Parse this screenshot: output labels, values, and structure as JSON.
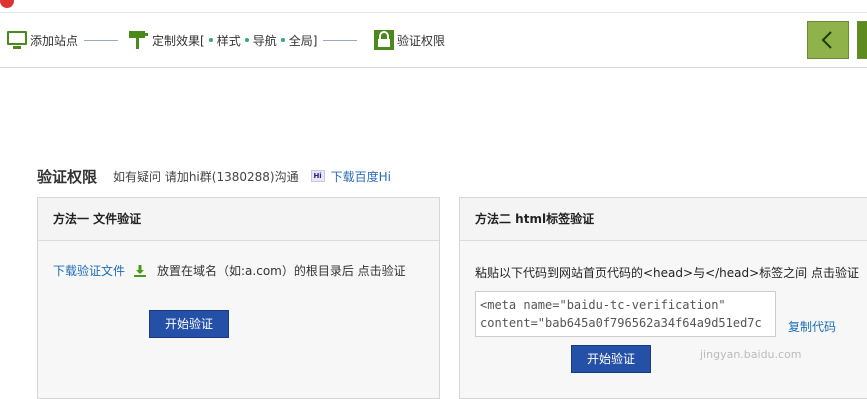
{
  "steps": {
    "add_site": "添加站点",
    "customize_prefix": "定制效果[",
    "style": "样式",
    "nav": "导航",
    "global": "全局]",
    "verify": "验证权限"
  },
  "header": {
    "title": "验证权限",
    "help": "如有疑问 请加hi群(1380288)沟通",
    "download_hi": "下载百度Hi"
  },
  "method1": {
    "title": "方法一 文件验证",
    "download_link": "下载验证文件",
    "instruction": "放置在域名（如:a.com）的根目录后 点击验证",
    "button": "开始验证"
  },
  "method2": {
    "title": "方法二 html标签验证",
    "instruction": "粘贴以下代码到网站首页代码的<head>与</head>标签之间 点击验证",
    "code_line1": "<meta name=\"baidu-tc-verification\"",
    "code_line2": "content=\"bab645a0f796562a34f64a9d51ed7c",
    "copy": "复制代码",
    "button": "开始验证"
  },
  "watermark": "jingyan.baidu.com",
  "colors": {
    "nav_green": "#7ea23e",
    "button_blue": "#2550a8",
    "link_blue": "#1b6db8"
  }
}
